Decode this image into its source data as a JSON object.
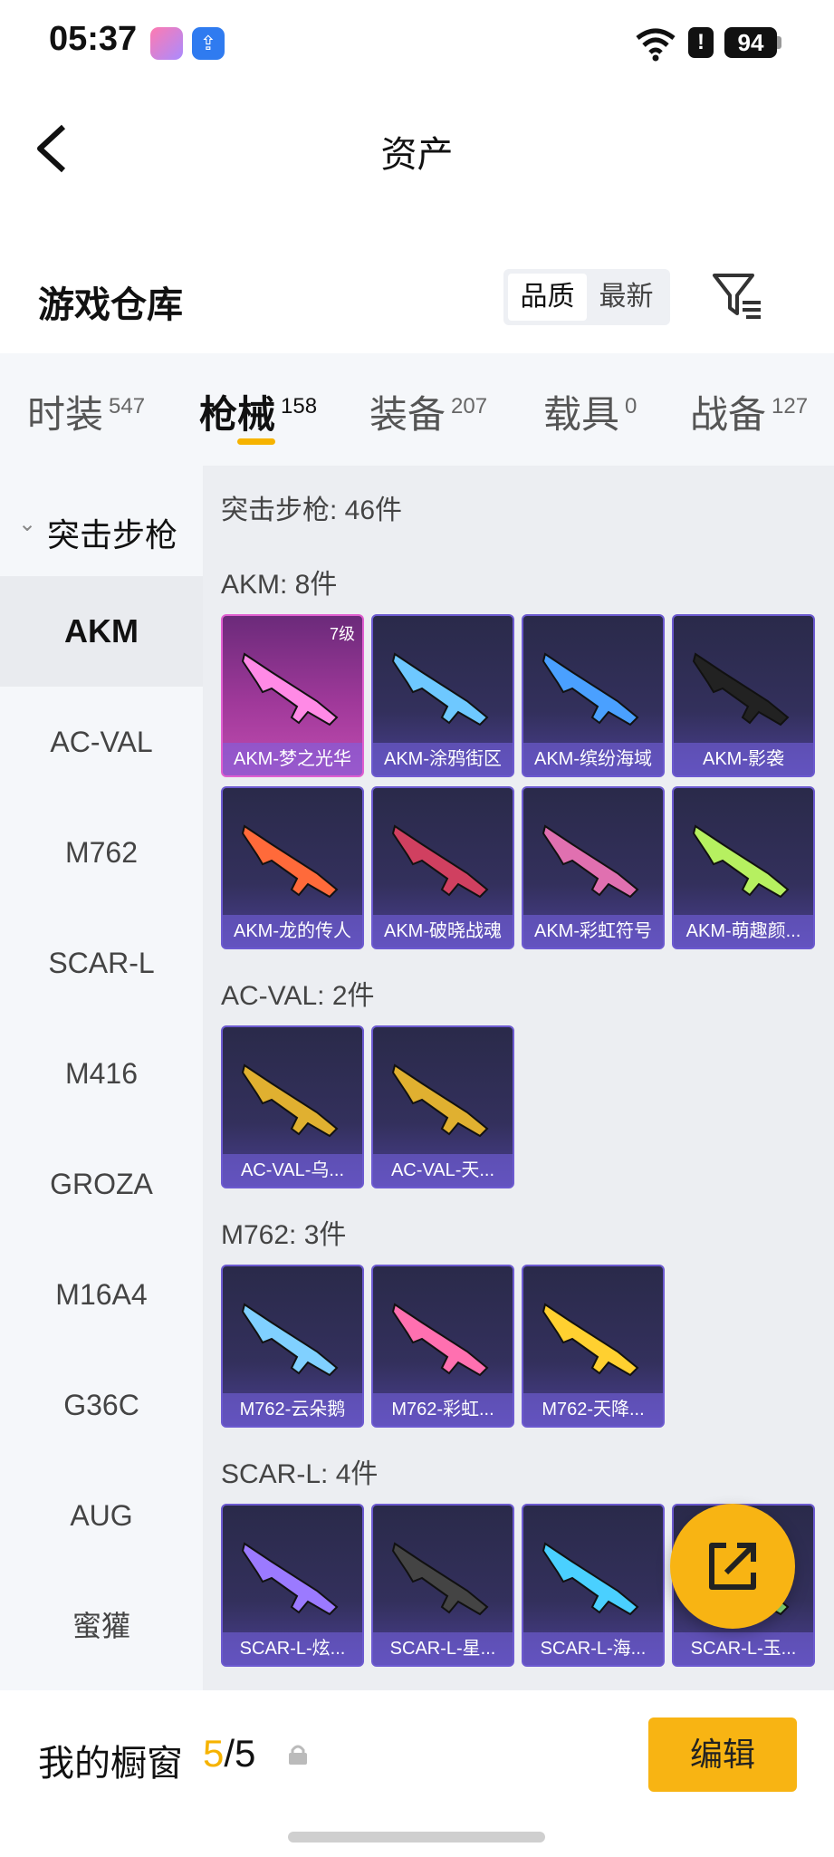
{
  "status_bar": {
    "time": "05:37",
    "battery": "94",
    "icons": [
      "app-icon-pink",
      "app-icon-blue-upload",
      "wifi-icon",
      "alert-icon",
      "battery-icon"
    ]
  },
  "nav": {
    "title": "资产",
    "back_icon": "back-arrow-icon"
  },
  "warehouse": {
    "title": "游戏仓库",
    "sort_options": [
      "品质",
      "最新"
    ],
    "filter_icon": "filter-icon"
  },
  "tabs": [
    {
      "label": "时装",
      "count": "547"
    },
    {
      "label": "枪械",
      "count": "158"
    },
    {
      "label": "装备",
      "count": "207"
    },
    {
      "label": "载具",
      "count": "0"
    },
    {
      "label": "战备",
      "count": "127"
    }
  ],
  "sidebar": {
    "group": "突击步枪",
    "items": [
      "AKM",
      "AC-VAL",
      "M762",
      "SCAR-L",
      "M416",
      "GROZA",
      "M16A4",
      "G36C",
      "AUG",
      "蜜獾"
    ]
  },
  "content": {
    "section_title": "突击步枪: 46件",
    "groups": [
      {
        "title": "AKM: 8件",
        "items": [
          {
            "name": "AKM-梦之光华",
            "level": "7级"
          },
          {
            "name": "AKM-涂鸦街区"
          },
          {
            "name": "AKM-缤纷海域"
          },
          {
            "name": "AKM-影袭"
          },
          {
            "name": "AKM-龙的传人"
          },
          {
            "name": "AKM-破晓战魂"
          },
          {
            "name": "AKM-彩虹符号"
          },
          {
            "name": "AKM-萌趣颜..."
          }
        ]
      },
      {
        "title": "AC-VAL: 2件",
        "items": [
          {
            "name": "AC-VAL-乌..."
          },
          {
            "name": "AC-VAL-天..."
          }
        ]
      },
      {
        "title": "M762: 3件",
        "items": [
          {
            "name": "M762-云朵鹅"
          },
          {
            "name": "M762-彩虹..."
          },
          {
            "name": "M762-天降..."
          }
        ]
      },
      {
        "title": "SCAR-L: 4件",
        "items": [
          {
            "name": "SCAR-L-炫..."
          },
          {
            "name": "SCAR-L-星..."
          },
          {
            "name": "SCAR-L-海..."
          },
          {
            "name": "SCAR-L-玉..."
          }
        ]
      }
    ]
  },
  "share_icon": "share-external-icon",
  "bottom_bar": {
    "label": "我的橱窗",
    "count_current": "5",
    "count_sep": "/5",
    "lock_icon": "lock-icon",
    "edit_label": "编辑"
  },
  "colors": {
    "accent": "#f8b413",
    "card_purple": "#33305c",
    "card_pink": "#a0399a"
  }
}
